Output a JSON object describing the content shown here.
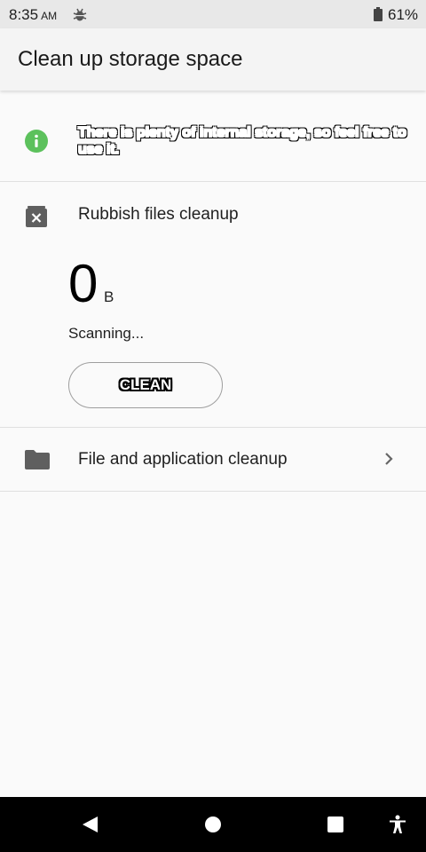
{
  "status_bar": {
    "time": "8:35",
    "ampm": "AM",
    "battery_percent": "61%",
    "icons": [
      "bug-icon",
      "battery-icon"
    ]
  },
  "app_bar": {
    "title": "Clean up storage space"
  },
  "info": {
    "icon": "info-icon",
    "accent_color": "#5cc15c",
    "message": "There is plenty of internal storage, so feel free to use it."
  },
  "rubbish": {
    "icon": "close-box-icon",
    "title": "Rubbish files cleanup",
    "size_value": "0",
    "size_unit": "B",
    "status": "Scanning...",
    "button_label": "CLEAN"
  },
  "file_cleanup": {
    "icon": "folder-icon",
    "title": "File and application cleanup",
    "chevron": "chevron-right-icon"
  },
  "nav_bar": {
    "items": [
      "back-icon",
      "home-icon",
      "recents-icon",
      "accessibility-icon"
    ]
  }
}
